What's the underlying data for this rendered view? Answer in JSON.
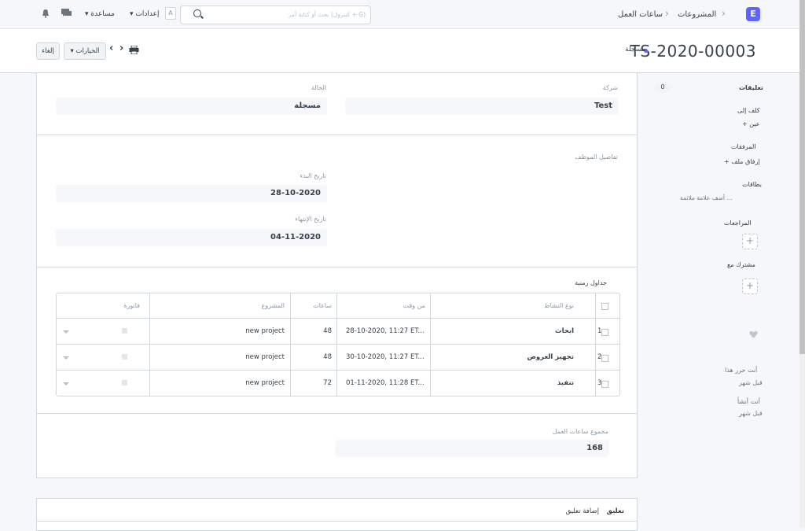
{
  "navbar": {
    "logo": "E",
    "breadcrumbs": [
      "المشروعات",
      "ساعات العمل"
    ],
    "search_placeholder": "بحث أو كتابة أمر (كنترول + G)",
    "settings_label": "إعدادات",
    "help_label": "مساعدة",
    "avatar_letter": "A"
  },
  "page": {
    "title": "TS-2020-00003",
    "status": "مسجلة",
    "options_label": "الخيارات",
    "cancel_label": "إلغاء"
  },
  "sidebar": {
    "comments_label": "تعليقات",
    "comments_count": "0",
    "assigned_to_label": "كلف إلى",
    "assign_link": "+ عين",
    "attachments_label": "المرفقات",
    "attach_link": "+ إرفاق ملف",
    "tags_label": "بطاقات",
    "add_tag_link": "أضف علامة ملائمة ...",
    "reviews_label": "المراجعات",
    "shared_with_label": "مشترك مع",
    "edited_by": "أنت حرر هذا",
    "edited_when": "قبل شهر",
    "created_by": "أنت أنشأ",
    "created_when": "قبل شهر"
  },
  "form": {
    "company_label": "شركة",
    "company_value": "Test",
    "status_label": "الحالة",
    "status_value": "مسجلة",
    "employee_details_label": "تفاصيل الموظف",
    "start_date_label": "تاريخ البدء",
    "start_date_value": "28-10-2020",
    "end_date_label": "تاريخ الإنتهاء",
    "end_date_value": "04-11-2020",
    "timesheet_label": "جداول زمنية",
    "total_hours_label": "مجموع ساعات العمل",
    "total_hours_value": "168"
  },
  "table": {
    "headers": {
      "activity_type": "نوع النشاط",
      "from_time": "من وقت",
      "hours": "ساعات",
      "project": "المشروع",
      "billable": "فاتورة"
    },
    "rows": [
      {
        "idx": "1",
        "activity": "ابحاث",
        "from_time": "28-10-2020, 11:27 ET...",
        "hours": "48",
        "project": "new project"
      },
      {
        "idx": "2",
        "activity": "تجهيز العروض",
        "from_time": "30-10-2020, 11:27 ET...",
        "hours": "48",
        "project": "new project"
      },
      {
        "idx": "3",
        "activity": "تنفيذ",
        "from_time": "01-11-2020, 11:28 ET...",
        "hours": "72",
        "project": "new project"
      }
    ]
  },
  "comment": {
    "tab_comment": "تعليق",
    "tab_add": "إضافة تعليق"
  }
}
